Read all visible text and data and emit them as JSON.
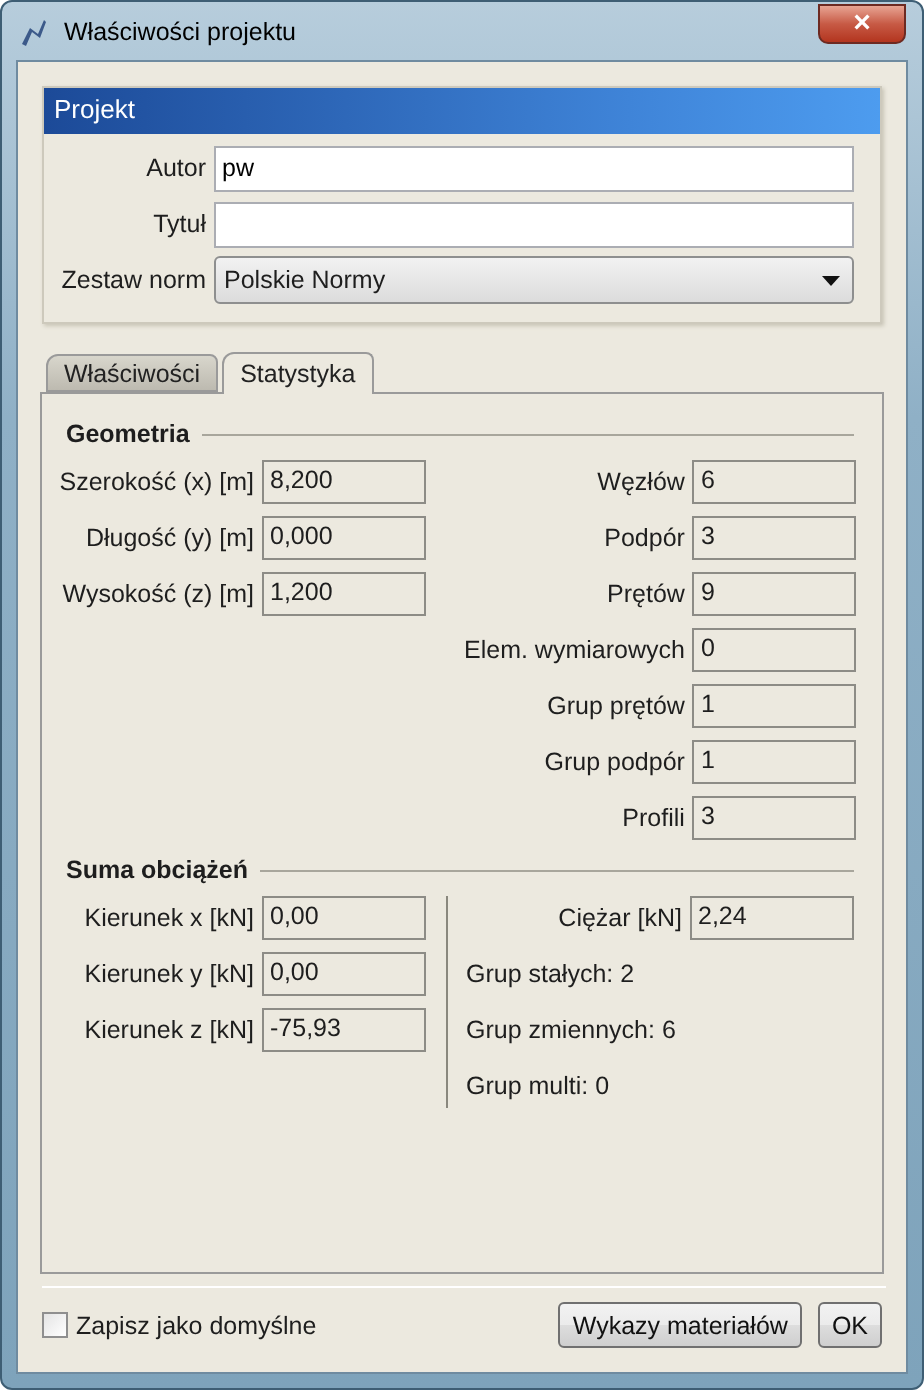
{
  "window": {
    "title": "Właściwości projektu",
    "close": "×"
  },
  "project": {
    "title": "Projekt",
    "fields": [
      {
        "kind": "text",
        "label": "Autor",
        "value": "pw"
      },
      {
        "kind": "text",
        "label": "Tytuł"
      },
      {
        "kind": "select",
        "label": "Zestaw norm",
        "value": "Polskie Normy"
      }
    ]
  },
  "tabs": [
    {
      "label": "Właściwości",
      "selected": false
    },
    {
      "label": "Statystyka",
      "selected": true
    }
  ],
  "geometry": {
    "title": "Geometria",
    "left": [
      {
        "kind": "field",
        "label": "Szerokość (x) [m]",
        "value": "8,200"
      },
      {
        "kind": "field",
        "label": "Długość (y) [m]",
        "value": "0,000"
      },
      {
        "kind": "field",
        "label": "Wysokość (z) [m]",
        "value": "1,200"
      }
    ],
    "right": [
      {
        "kind": "field",
        "label": "Węzłów",
        "value": "6"
      },
      {
        "kind": "field",
        "label": "Podpór",
        "value": "3"
      },
      {
        "kind": "field",
        "label": "Prętów",
        "value": "9"
      },
      {
        "kind": "field",
        "label": "Elem. wymiarowych",
        "value": "0"
      },
      {
        "kind": "field",
        "label": "Grup prętów",
        "value": "1"
      },
      {
        "kind": "field",
        "label": "Grup podpór",
        "value": "1"
      },
      {
        "kind": "field",
        "label": "Profili",
        "value": "3"
      }
    ]
  },
  "loads": {
    "title": "Suma obciążeń",
    "left": [
      {
        "kind": "field",
        "label": "Kierunek x [kN]",
        "value": "0,00"
      },
      {
        "kind": "field",
        "label": "Kierunek y [kN]",
        "value": "0,00"
      },
      {
        "kind": "field",
        "label": "Kierunek z [kN]",
        "value": "-75,93"
      }
    ],
    "right": [
      {
        "kind": "field",
        "label": "Ciężar [kN]",
        "value": "2,24"
      },
      {
        "kind": "text",
        "text": "Grup stałych: 2"
      },
      {
        "kind": "text",
        "text": "Grup zmiennych: 6"
      },
      {
        "kind": "text",
        "text": "Grup multi: 0"
      }
    ]
  },
  "footer": {
    "checkbox": {
      "label": "Zapisz jako domyślne",
      "checked": false
    },
    "buttons": [
      "Wykazy materiałów",
      "OK"
    ]
  }
}
